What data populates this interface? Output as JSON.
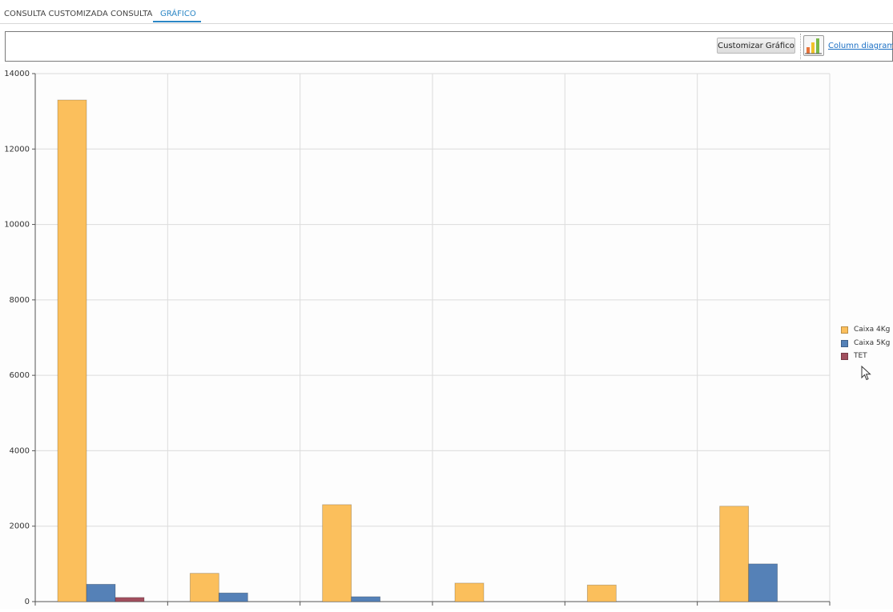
{
  "tabs": [
    {
      "label": "CONSULTA CUSTOMIZADA",
      "active": false
    },
    {
      "label": "CONSULTA",
      "active": false
    },
    {
      "label": "GRÁFICO",
      "active": true
    }
  ],
  "toolbar": {
    "customize_label": "Customizar Gráfico",
    "chart_type_icon": "column-chart-icon",
    "chart_type_link": "Column diagram"
  },
  "colors": {
    "accent": "#2b86c5",
    "series": [
      "#fbbf5c",
      "#5581b7",
      "#a14f5e"
    ]
  },
  "chart_data": {
    "type": "bar",
    "categories": [
      "",
      "",
      "",
      "",
      "",
      ""
    ],
    "series": [
      {
        "name": "Caixa 4Kg",
        "values": [
          13300,
          750,
          2570,
          490,
          440,
          2530
        ]
      },
      {
        "name": "Caixa 5Kg",
        "values": [
          460,
          230,
          130,
          0,
          0,
          1000
        ]
      },
      {
        "name": "TET",
        "values": [
          110,
          0,
          0,
          0,
          0,
          0
        ]
      }
    ],
    "yticks": [
      "0",
      "2000",
      "4000",
      "6000",
      "8000",
      "10000",
      "12000",
      "14000"
    ],
    "ylim": [
      0,
      14000
    ],
    "grid": true,
    "legend_position": "right"
  }
}
